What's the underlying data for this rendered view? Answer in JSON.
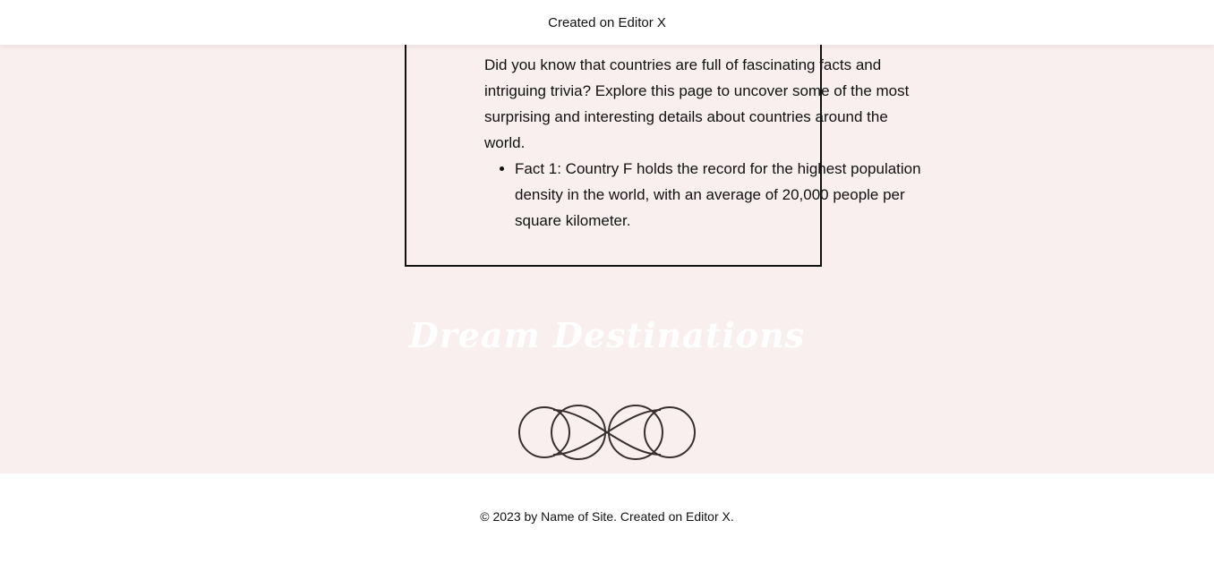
{
  "header": {
    "site_credit": "Created on Editor X"
  },
  "facts": {
    "intro": "Did you know that countries are full of fascinating facts and intriguing trivia? Explore this page to uncover some of the most surprising and interesting details about countries around the world.",
    "items": [
      "Fact 1: Country F holds the record for the highest population density in the world, with an average of 20,000 people per square kilometer."
    ]
  },
  "destinations": {
    "title": "Dream Destinations"
  },
  "decoration": {
    "icon": "infinity-ornament-icon",
    "stroke_color": "#3a2e2e"
  },
  "footer": {
    "copyright": "© 2023 by Name of Site. Created on Editor X."
  },
  "colors": {
    "page_background": "#f9efef",
    "header_background": "#ffffff",
    "title_color": "#ffffff"
  }
}
